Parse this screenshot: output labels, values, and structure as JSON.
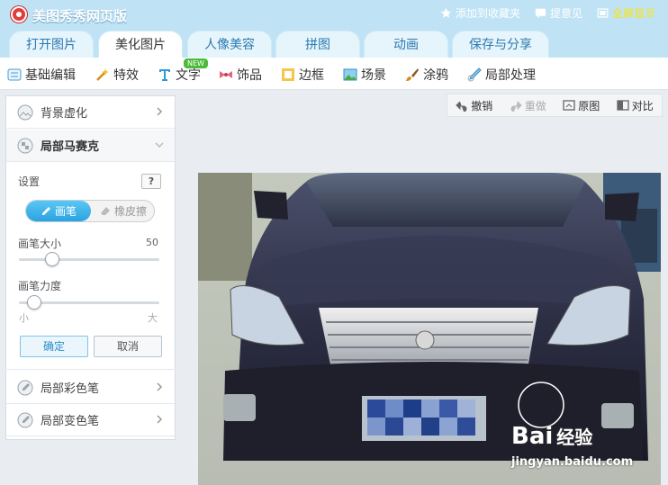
{
  "app": {
    "title": "美图秀秀网页版"
  },
  "topbar": {
    "favorite": "添加到收藏夹",
    "feedback": "提意见",
    "fullscreen": "全屏显示"
  },
  "tabs": [
    {
      "label": "打开图片",
      "active": false
    },
    {
      "label": "美化图片",
      "active": true
    },
    {
      "label": "人像美容",
      "active": false
    },
    {
      "label": "拼图",
      "active": false
    },
    {
      "label": "动画",
      "active": false
    },
    {
      "label": "保存与分享",
      "active": false
    }
  ],
  "subtools": [
    {
      "label": "基础编辑",
      "icon": "sliders-icon"
    },
    {
      "label": "特效",
      "icon": "magic-wand-icon"
    },
    {
      "label": "文字",
      "icon": "text-icon",
      "badge": "NEW"
    },
    {
      "label": "饰品",
      "icon": "bow-icon"
    },
    {
      "label": "边框",
      "icon": "frame-icon"
    },
    {
      "label": "场景",
      "icon": "landscape-icon"
    },
    {
      "label": "涂鸦",
      "icon": "brush-icon"
    },
    {
      "label": "局部处理",
      "icon": "local-edit-icon"
    }
  ],
  "panel": {
    "bg_blur": "背景虚化",
    "mosaic": "局部马赛克",
    "settings": "设置",
    "help": "?",
    "brush": "画笔",
    "eraser": "橡皮擦",
    "brush_size_label": "画笔大小",
    "brush_size_value": "50",
    "brush_size_fraction": 0.24,
    "brush_strength_label": "画笔力度",
    "brush_strength_fraction": 0.11,
    "min_label": "小",
    "max_label": "大",
    "confirm": "确定",
    "cancel": "取消",
    "color_pen": "局部彩色笔",
    "change_color_pen": "局部变色笔"
  },
  "canvas_tools": {
    "undo": "撤销",
    "redo": "重做",
    "original": "原图",
    "compare": "对比"
  },
  "watermark": {
    "logo": "Bai",
    "logo_suffix": "经验",
    "url": "jingyan.baidu.com"
  },
  "colors": {
    "accent": "#2aa3e0",
    "titlebar": "#bfe3f5",
    "full_screen": "#ffe400"
  }
}
